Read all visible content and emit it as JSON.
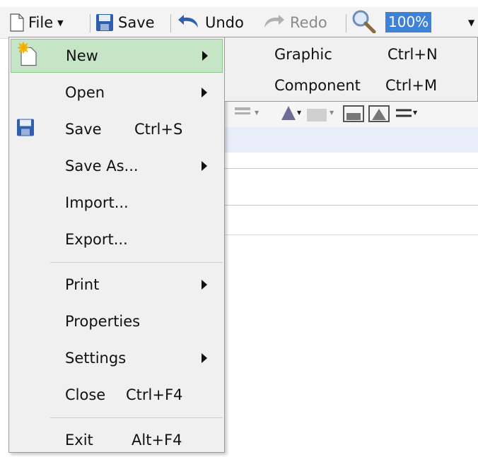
{
  "toolbar": {
    "file_label": "File",
    "save_label": "Save",
    "undo_label": "Undo",
    "redo_label": "Redo",
    "zoom_value": "100%"
  },
  "file_menu": {
    "items": [
      {
        "label": "New",
        "shortcut": "",
        "has_submenu": true
      },
      {
        "label": "Open",
        "shortcut": "",
        "has_submenu": true
      },
      {
        "label": "Save",
        "shortcut": "Ctrl+S",
        "has_submenu": false
      },
      {
        "label": "Save As...",
        "shortcut": "",
        "has_submenu": true
      },
      {
        "label": "Import...",
        "shortcut": "",
        "has_submenu": false
      },
      {
        "label": "Export...",
        "shortcut": "",
        "has_submenu": false
      },
      {
        "label": "Print",
        "shortcut": "",
        "has_submenu": true
      },
      {
        "label": "Properties",
        "shortcut": "",
        "has_submenu": false
      },
      {
        "label": "Settings",
        "shortcut": "",
        "has_submenu": true
      },
      {
        "label": "Close",
        "shortcut": "Ctrl+F4",
        "has_submenu": false
      },
      {
        "label": "Exit",
        "shortcut": "Alt+F4",
        "has_submenu": false
      }
    ]
  },
  "new_submenu": {
    "items": [
      {
        "label": "Graphic",
        "shortcut": "Ctrl+N"
      },
      {
        "label": "Component",
        "shortcut": "Ctrl+M"
      }
    ]
  },
  "colors": {
    "highlight": "#c6e5c6",
    "zoom_selection": "#3d82d6",
    "icon_blue": "#2f5fae"
  },
  "icons": [
    "document-icon",
    "floppy-disk-icon",
    "undo-icon",
    "redo-icon",
    "magnifier-icon",
    "new-document-icon",
    "chevron-down-icon"
  ]
}
